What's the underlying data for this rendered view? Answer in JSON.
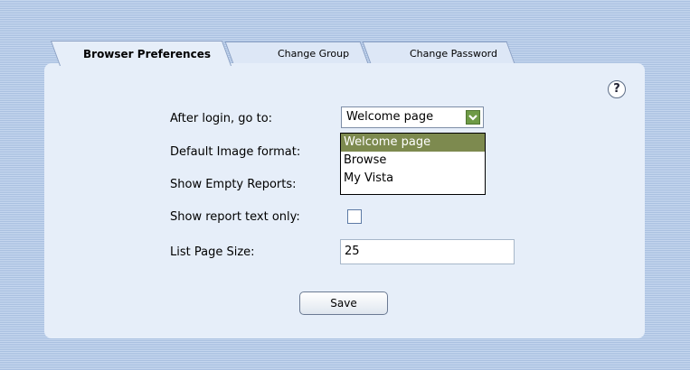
{
  "tabs": [
    {
      "label": "Browser Preferences",
      "active": true
    },
    {
      "label": "Change Group",
      "active": false
    },
    {
      "label": "Change Password",
      "active": false
    }
  ],
  "help_glyph": "?",
  "fields": {
    "after_login_label": "After login, go to:",
    "after_login_value": "Welcome page",
    "after_login_options": [
      "Welcome page",
      "Browse",
      "My Vista"
    ],
    "image_format_label": "Default Image format:",
    "empty_reports_label": "Show Empty Reports:",
    "text_only_label": "Show report text only:",
    "text_only_checked": false,
    "page_size_label": "List Page Size:",
    "page_size_value": "25"
  },
  "save_label": "Save",
  "colors": {
    "background": "#b9cde8",
    "panel": "#e6eef9",
    "select_arrow": "#6e9a46",
    "selected_option": "#7d8a4f"
  }
}
